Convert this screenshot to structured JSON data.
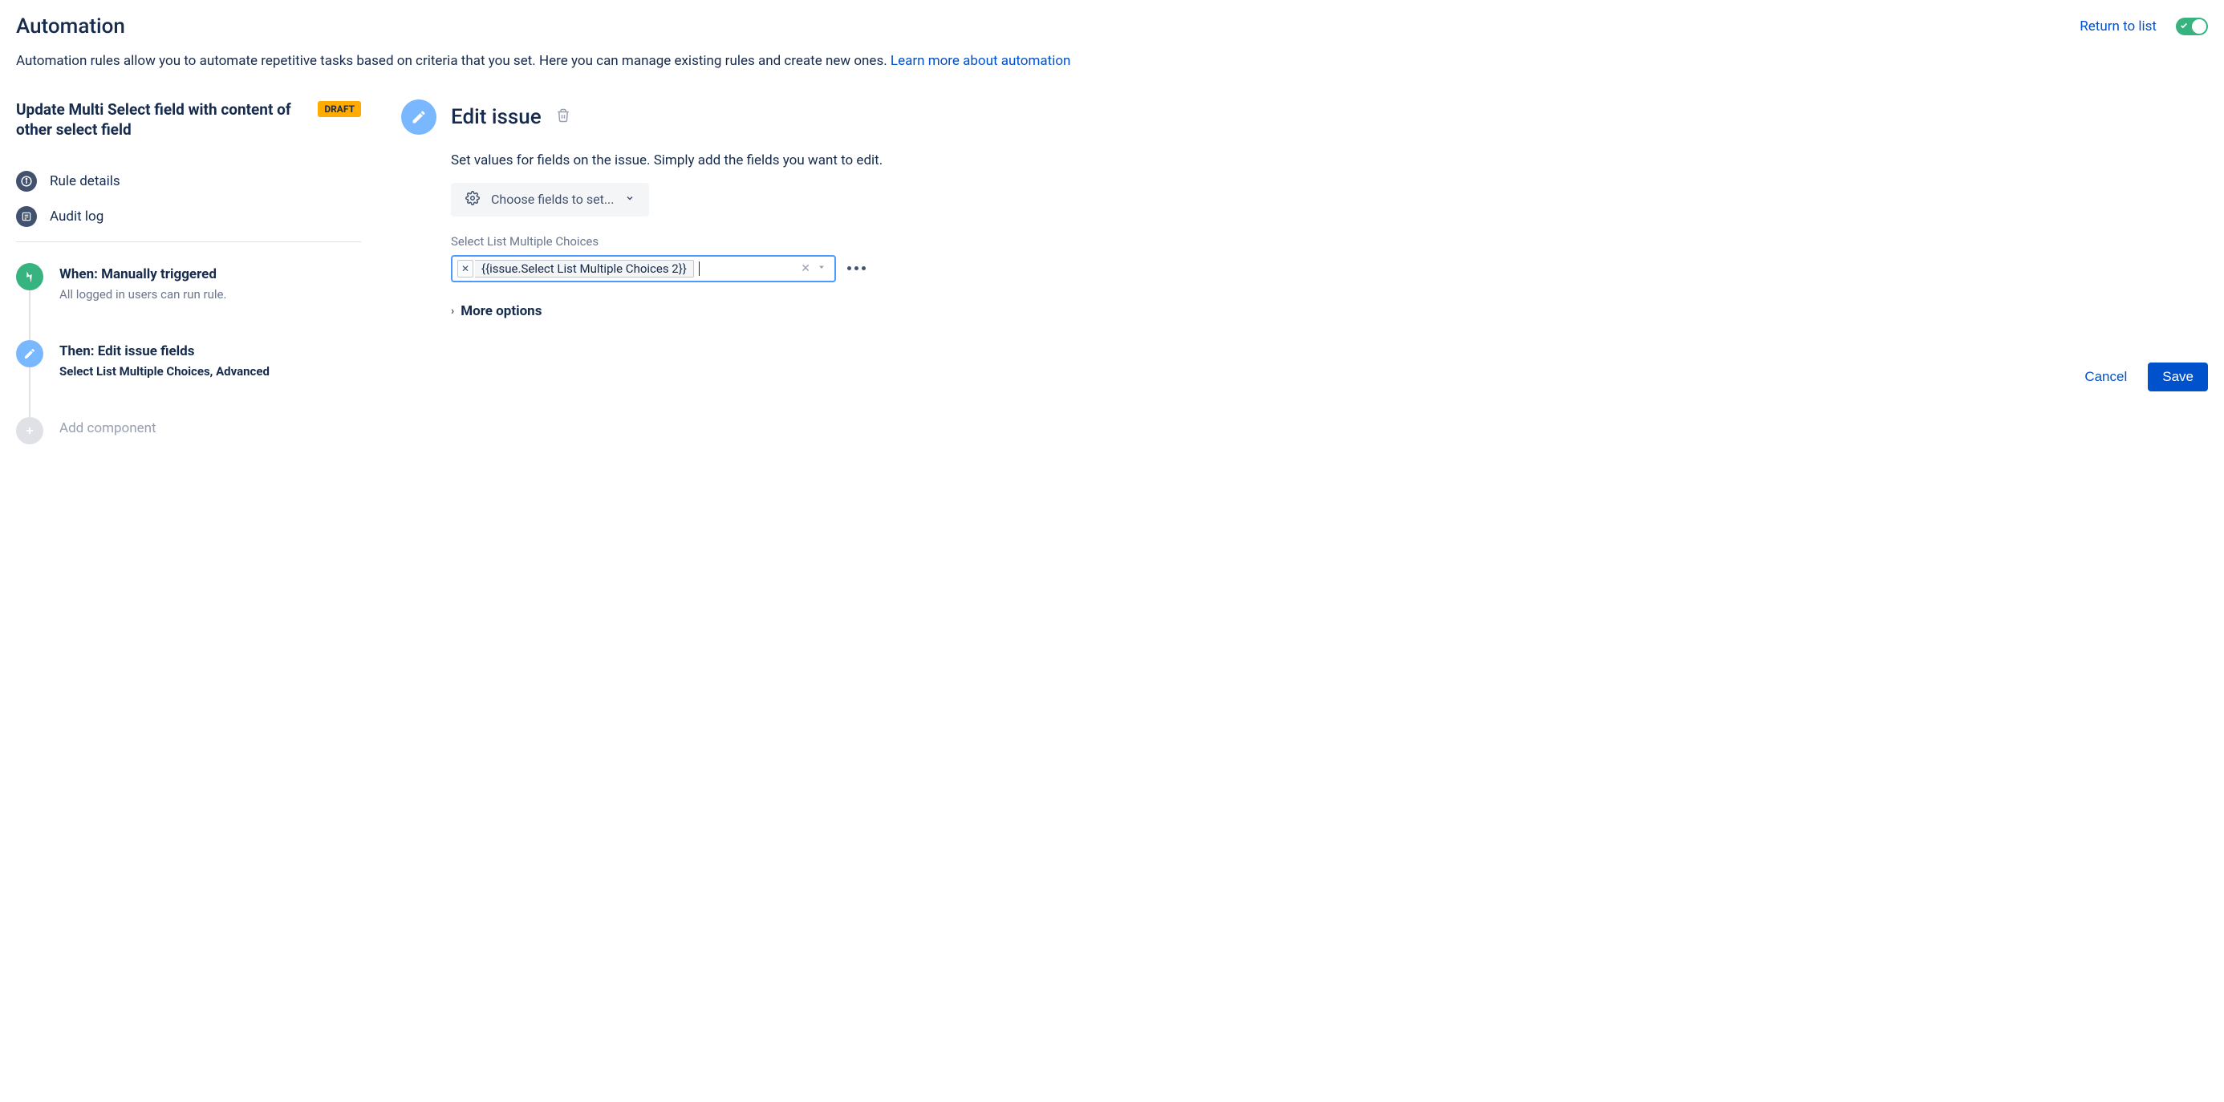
{
  "header": {
    "title": "Automation",
    "return_link": "Return to list",
    "description": "Automation rules allow you to automate repetitive tasks based on criteria that you set. Here you can manage existing rules and create new ones. ",
    "learn_more": "Learn more about automation"
  },
  "rule": {
    "name": "Update Multi Select field with content of other select field",
    "badge": "DRAFT"
  },
  "side_links": {
    "details": "Rule details",
    "audit": "Audit log"
  },
  "flow": {
    "trigger_title": "When: Manually triggered",
    "trigger_sub": "All logged in users can run rule.",
    "action_title": "Then: Edit issue fields",
    "action_sub": "Select List Multiple Choices, Advanced",
    "add_component": "Add component"
  },
  "edit_panel": {
    "title": "Edit issue",
    "description": "Set values for fields on the issue. Simply add the fields you want to edit.",
    "choose_fields_label": "Choose fields to set...",
    "field_label": "Select List Multiple Choices",
    "chip_value": "{{issue.Select List Multiple Choices 2}}",
    "more_options": "More options",
    "cancel": "Cancel",
    "save": "Save"
  }
}
